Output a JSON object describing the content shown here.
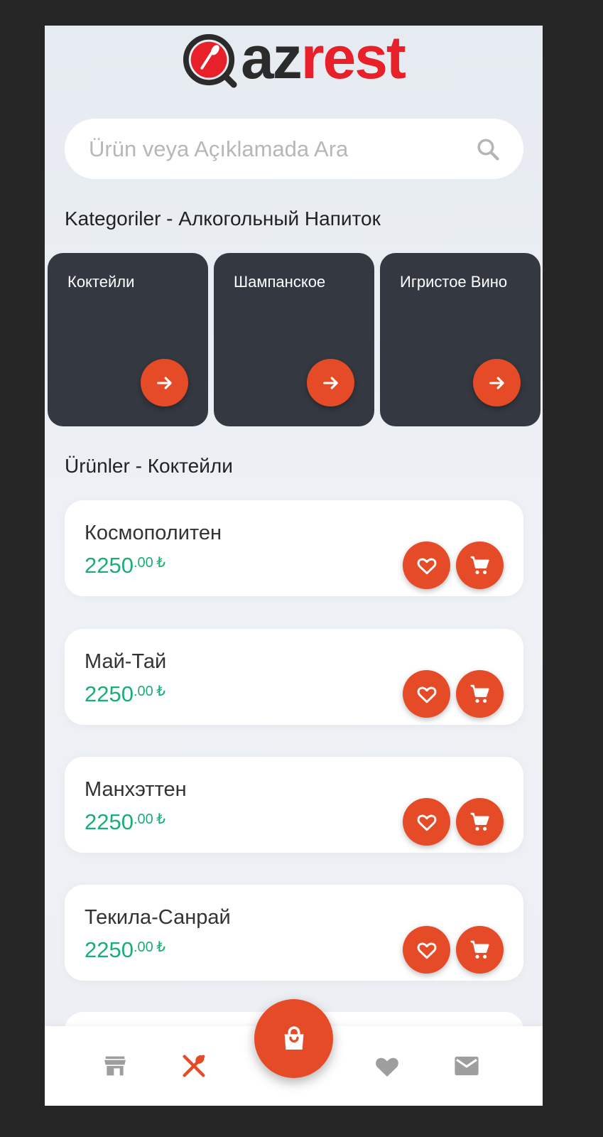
{
  "brand": {
    "logo_part1": "az",
    "logo_part2": "rest",
    "colors": {
      "accent": "#e54b27",
      "logo_red": "#e8202a",
      "price_green": "#1aad74",
      "card_dark": "#343840"
    }
  },
  "search": {
    "placeholder": "Ürün veya Açıklamada Ara",
    "value": "",
    "icon": "search-icon"
  },
  "categories": {
    "title": "Kategoriler - Алкогольный Напиток",
    "items": [
      {
        "label": "Коктейли",
        "icon": "arrow-right-icon"
      },
      {
        "label": "Шампанское",
        "icon": "arrow-right-icon"
      },
      {
        "label": "Игристое Вино",
        "icon": "arrow-right-icon"
      }
    ]
  },
  "products": {
    "title": "Ürünler - Коктейли",
    "items": [
      {
        "name": "Космополитен",
        "price_main": "2250",
        "price_decimal": ".00",
        "currency": "₺"
      },
      {
        "name": "Май-Тай",
        "price_main": "2250",
        "price_decimal": ".00",
        "currency": "₺"
      },
      {
        "name": "Манхэттен",
        "price_main": "2250",
        "price_decimal": ".00",
        "currency": "₺"
      },
      {
        "name": "Текила-Санрай",
        "price_main": "2250",
        "price_decimal": ".00",
        "currency": "₺"
      }
    ]
  },
  "bottom_nav": {
    "items": [
      {
        "icon": "store-icon",
        "active": false
      },
      {
        "icon": "fork-knife-icon",
        "active": true
      },
      {
        "icon": "shopping-bag-icon",
        "active": false
      },
      {
        "icon": "heart-icon",
        "active": false
      },
      {
        "icon": "mail-icon",
        "active": false
      }
    ]
  }
}
